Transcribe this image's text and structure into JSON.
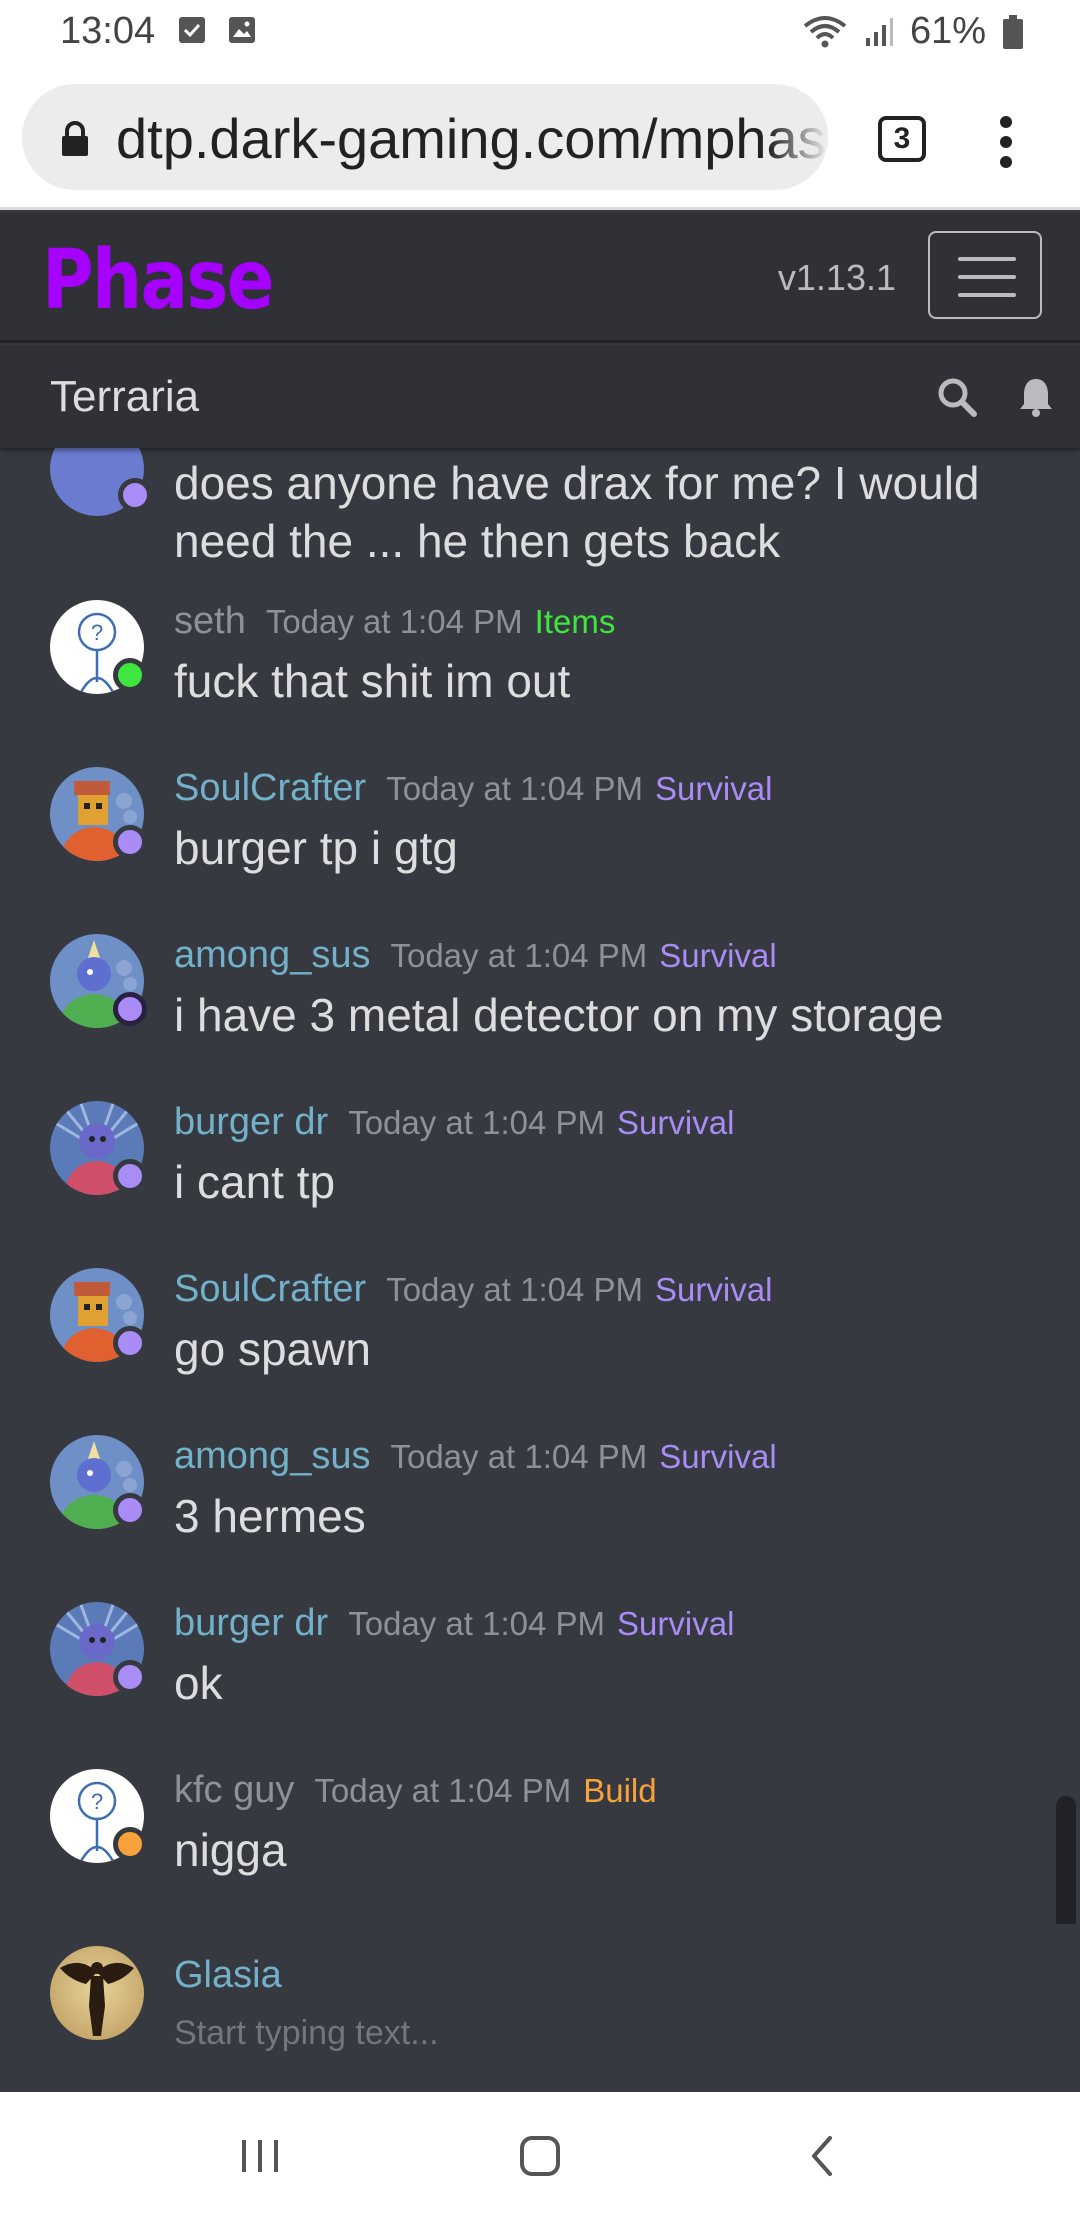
{
  "status_bar": {
    "time": "13:04",
    "battery": "61%"
  },
  "browser": {
    "url": "dtp.dark-gaming.com/mphase",
    "tab_count": "3"
  },
  "app": {
    "brand": "Phase",
    "version": "v1.13.1"
  },
  "channel": {
    "name": "Terraria"
  },
  "messages": [
    {
      "username": "",
      "timestamp": "",
      "role": "",
      "text": "does anyone have drax for me? I would",
      "text2": "need the ... he then gets back"
    },
    {
      "username": "seth",
      "timestamp": "Today at 1:04 PM",
      "role": "Items",
      "text": "fuck that shit im out"
    },
    {
      "username": "SoulCrafter",
      "timestamp": "Today at 1:04 PM",
      "role": "Survival",
      "text": "burger tp i gtg"
    },
    {
      "username": "among_sus",
      "timestamp": "Today at 1:04 PM",
      "role": "Survival",
      "text": "i have 3 metal detector on my storage"
    },
    {
      "username": "burger dr",
      "timestamp": "Today at 1:04 PM",
      "role": "Survival",
      "text": "i cant tp"
    },
    {
      "username": "SoulCrafter",
      "timestamp": "Today at 1:04 PM",
      "role": "Survival",
      "text": "go spawn"
    },
    {
      "username": "among_sus",
      "timestamp": "Today at 1:04 PM",
      "role": "Survival",
      "text": "3 hermes"
    },
    {
      "username": "burger dr",
      "timestamp": "Today at 1:04 PM",
      "role": "Survival",
      "text": "ok"
    },
    {
      "username": "kfc guy",
      "timestamp": "Today at 1:04 PM",
      "role": "Build",
      "text": "nigga"
    }
  ],
  "colors": {
    "items_role": "#3fe63f",
    "survival_role": "#a98cf5",
    "build_role": "#f7a23b",
    "online_dot": "#3fe63f",
    "purple_dot": "#a98cf5",
    "orange_dot": "#f7a23b",
    "brand": "#a600ff"
  },
  "composer": {
    "username": "Glasia",
    "placeholder": "Start typing text..."
  },
  "icons": {
    "status": [
      "checkbox-notification-icon",
      "image-notification-icon",
      "wifi-icon",
      "signal-icon",
      "battery-icon"
    ],
    "browser": [
      "lock-icon",
      "tabs-icon",
      "kebab-menu-icon"
    ],
    "header": [
      "hamburger-menu-icon",
      "search-icon",
      "bell-icon"
    ],
    "nav": [
      "recent-apps-icon",
      "home-icon",
      "back-icon"
    ]
  }
}
